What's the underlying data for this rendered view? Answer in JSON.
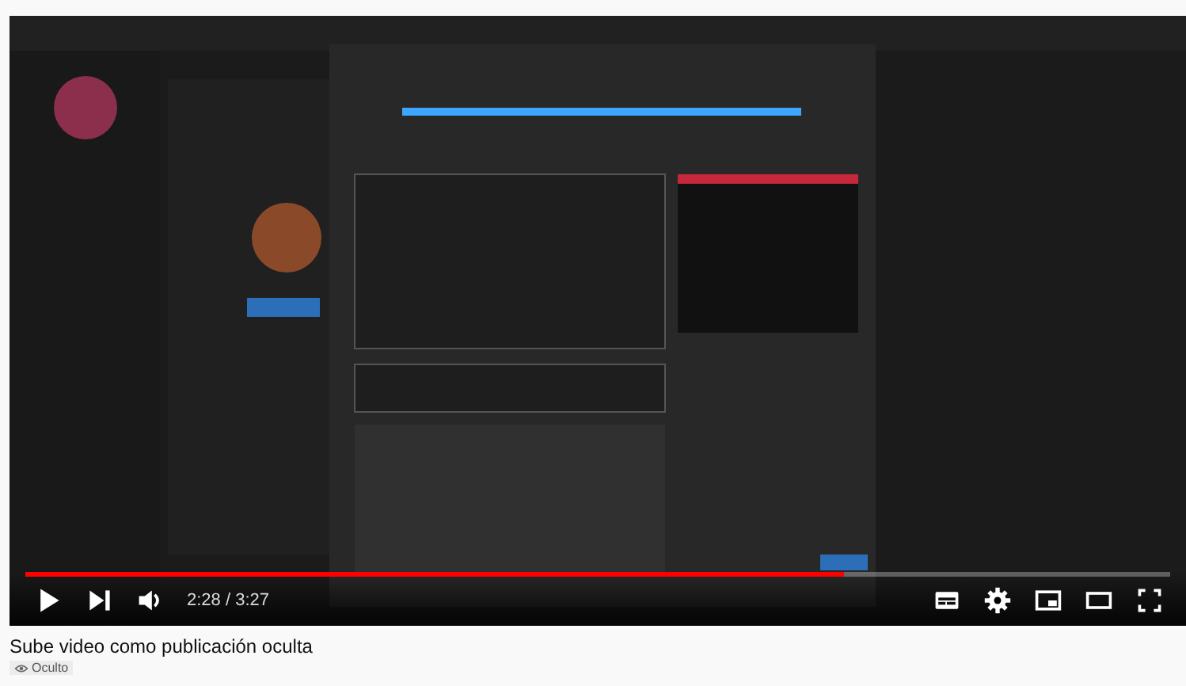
{
  "player": {
    "progress": {
      "level": 0.715
    },
    "time": "2:28 / 3:27"
  },
  "video_title": "Sube video como publicación oculta",
  "visibility_badge": {
    "label": "Oculto"
  }
}
